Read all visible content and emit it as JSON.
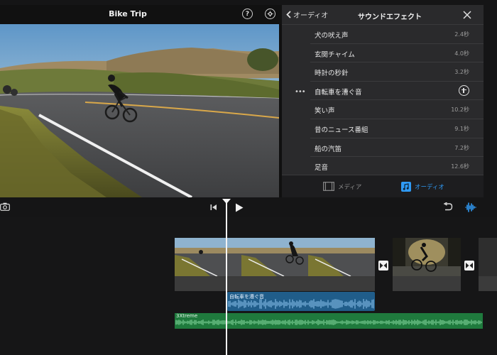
{
  "viewer": {
    "title": "Bike Trip",
    "help_icon": "question-mark-icon",
    "settings_icon": "settings-gear-icon"
  },
  "sound_panel": {
    "back_label": "オーディオ",
    "title": "サウンドエフェクト",
    "items": [
      {
        "name": "犬の吠え声",
        "duration": "2.4秒"
      },
      {
        "name": "玄関チャイム",
        "duration": "4.0秒"
      },
      {
        "name": "時計の秒針",
        "duration": "3.2秒"
      },
      {
        "name": "自転車を漕ぐ音",
        "duration": "",
        "selected": true
      },
      {
        "name": "笑い声",
        "duration": "10.2秒"
      },
      {
        "name": "昔のニュース番組",
        "duration": "9.1秒"
      },
      {
        "name": "船の汽笛",
        "duration": "7.2秒"
      },
      {
        "name": "足音",
        "duration": "12.6秒"
      }
    ],
    "tabs": [
      {
        "label": "メディア",
        "icon": "film-strip-icon",
        "active": false
      },
      {
        "label": "オーディオ",
        "icon": "music-note-icon",
        "active": true
      }
    ],
    "accent_color": "#2f9af5"
  },
  "timeline": {
    "sfx_clip_label": "自転車を漕ぐ音",
    "music_clip_label": "3Xtreme",
    "sfx_color": "#205d8a",
    "music_color": "#1f7a3d"
  }
}
